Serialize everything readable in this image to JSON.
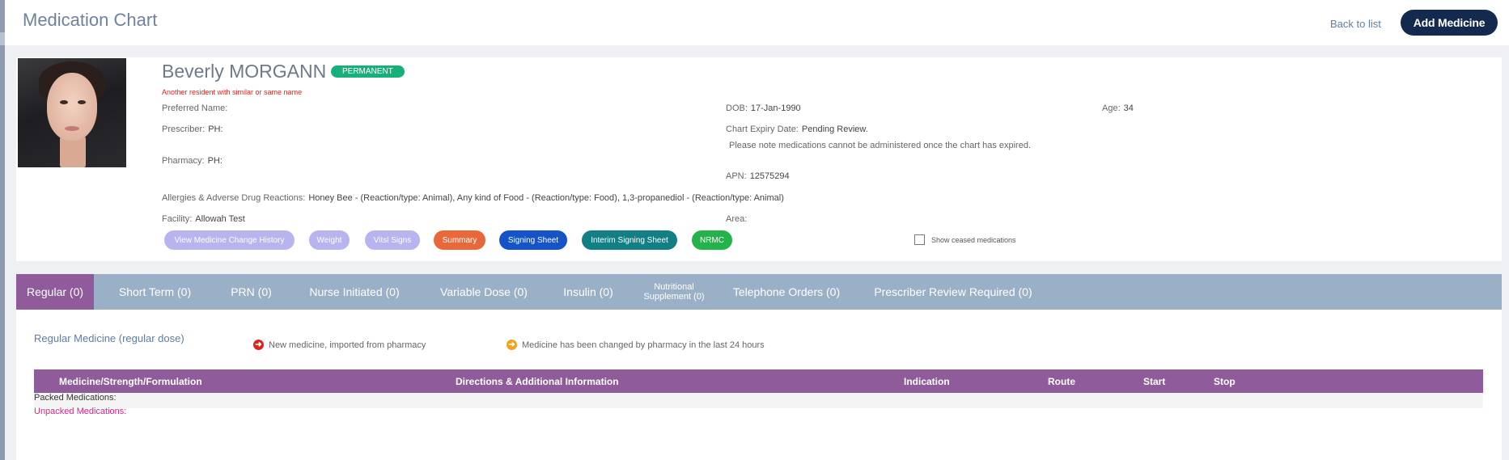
{
  "header": {
    "title": "Medication Chart",
    "back_link": "Back to list",
    "add_button": "Add Medicine"
  },
  "resident": {
    "name": "Beverly MORGANN",
    "status_badge": "PERMANENT",
    "warning": "Another resident with similar or same name",
    "preferred_name_label": "Preferred Name:",
    "preferred_name": "",
    "prescriber_label": "Prescriber:",
    "prescriber": "PH:",
    "pharmacy_label": "Pharmacy:",
    "pharmacy": "PH:",
    "dob_label": "DOB:",
    "dob": "17-Jan-1990",
    "age_label": "Age:",
    "age": "34",
    "expiry_label": "Chart Expiry Date:",
    "expiry": "Pending Review.",
    "expiry_note": "Please note medications cannot be administered once the chart has expired.",
    "apn_label": "APN:",
    "apn": "12575294",
    "allergies_label": "Allergies & Adverse Drug Reactions:",
    "allergies": "Honey Bee - (Reaction/type: Animal), Any kind of Food - (Reaction/type: Food), 1,3-propanediol - (Reaction/type: Animal)",
    "facility_label": "Facility:",
    "facility": "Allowah Test",
    "area_label": "Area:",
    "area": ""
  },
  "actions": [
    {
      "label": "View Medicine Change History",
      "color": "#b8b4f0"
    },
    {
      "label": "Weight",
      "color": "#b8b4f0"
    },
    {
      "label": "Vitsl Signs",
      "color": "#b8b4f0"
    },
    {
      "label": "Summary",
      "color": "#e8683a"
    },
    {
      "label": "Signing Sheet",
      "color": "#1553c8"
    },
    {
      "label": "Interim Signing Sheet",
      "color": "#127f84"
    },
    {
      "label": "NRMC",
      "color": "#24b34a"
    }
  ],
  "show_ceased_label": "Show ceased medications",
  "tabs": [
    {
      "label": "Regular (0)"
    },
    {
      "label": "Short Term (0)"
    },
    {
      "label": "PRN (0)"
    },
    {
      "label": "Nurse Initiated (0)"
    },
    {
      "label": "Variable Dose (0)"
    },
    {
      "label": "Insulin (0)"
    },
    {
      "label_line1": "Nutritional",
      "label_line2": "Supplement (0)"
    },
    {
      "label": "Telephone Orders (0)"
    },
    {
      "label": "Prescriber Review Required (0)"
    }
  ],
  "section": {
    "title": "Regular Medicine (regular dose)",
    "legend_new": "New medicine, imported from pharmacy",
    "legend_changed": "Medicine has been changed by pharmacy in the last 24 hours",
    "legend_new_icon": "arrow-right-red-icon",
    "legend_changed_icon": "arrow-right-orange-icon"
  },
  "table": {
    "headers": [
      "Medicine/Strength/Formulation",
      "Directions & Additional Information",
      "Indication",
      "Route",
      "Start",
      "Stop"
    ],
    "group_packed": "Packed Medications:",
    "group_unpacked": "Unpacked Medications:"
  }
}
